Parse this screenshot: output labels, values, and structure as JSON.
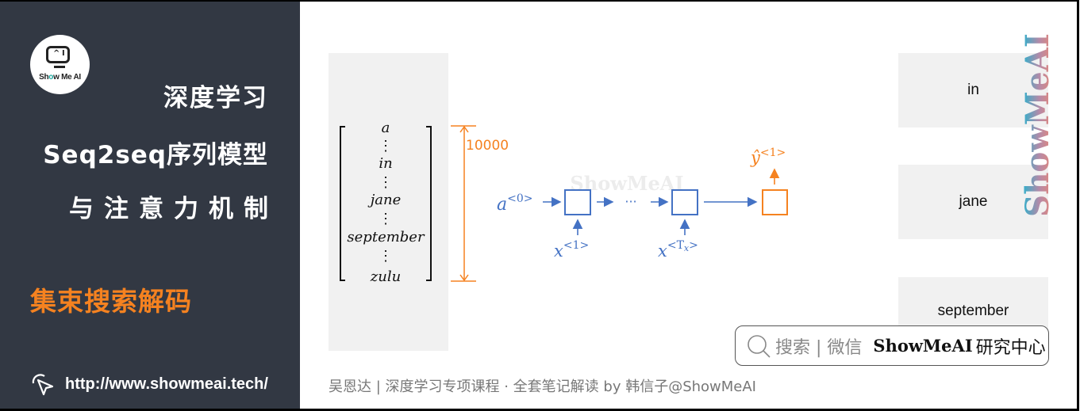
{
  "sidebar": {
    "logo_text": "Show Me AI",
    "logo_screen_glyph": "^ I",
    "course_title": "深度学习",
    "course_subtitle": "Seq2seq序列模型",
    "course_subtitle2": "与注意力机制",
    "section_title": "集束搜索解码",
    "url": "http://www.showmeai.tech/",
    "cursor_icon": "cursor-click-icon"
  },
  "diagram": {
    "vocab_entries": [
      "a",
      "⋮",
      "in",
      "⋮",
      "jane",
      "⋮",
      "september",
      "⋮",
      "zulu"
    ],
    "vocab_size_label": "10000",
    "initial_activation": "a",
    "initial_activation_sup": "<0>",
    "input_first": "x",
    "input_first_sup": "<1>",
    "input_last": "x",
    "input_last_sup_pre": "<T",
    "input_last_sub": "x",
    "input_last_sup_post": ">",
    "ellipsis": "···",
    "output": "ŷ",
    "output_sup": "<1>",
    "watermark": "ShowMeAI",
    "colors": {
      "rnn_blue": "#4472c4",
      "output_orange": "#f58220",
      "panel_gray": "#f1f1f1"
    }
  },
  "candidates": [
    "in",
    "jane",
    "september"
  ],
  "vertical_watermark": "ShowMeAI",
  "search_badge": {
    "icon": "search-icon",
    "hint": "搜索 | 微信",
    "brand": "ShowMeAI",
    "org": "研究中心"
  },
  "footer": {
    "credit": "吴恩达 | 深度学习专项课程 · 全套笔记解读  by 韩信子@ShowMeAI"
  }
}
